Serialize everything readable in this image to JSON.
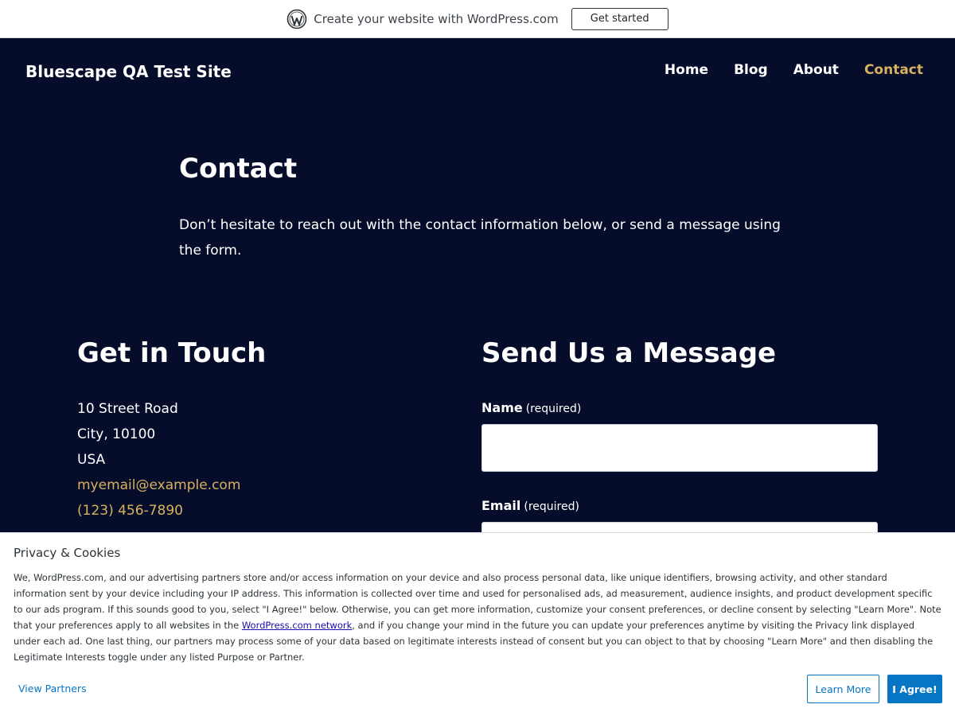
{
  "wp_banner": {
    "logo_icon": "wordpress-logo-icon",
    "text": "Create your website with WordPress.com",
    "button_label": "Get started"
  },
  "header": {
    "site_title": "Bluescape QA Test Site",
    "nav": [
      {
        "label": "Home",
        "active": false
      },
      {
        "label": "Blog",
        "active": false
      },
      {
        "label": "About",
        "active": false
      },
      {
        "label": "Contact",
        "active": true
      }
    ]
  },
  "intro": {
    "heading": "Contact",
    "text": "Don’t hesitate to reach out with the contact information below, or send a message using the form."
  },
  "get_in_touch": {
    "heading": "Get in Touch",
    "street": "10 Street Road",
    "city": "City, 10100",
    "country": "USA",
    "email": "myemail@example.com",
    "phone": "(123) 456-7890"
  },
  "form": {
    "heading": "Send Us a Message",
    "name_label": "Name",
    "name_required": "(required)",
    "name_value": "",
    "email_label": "Email",
    "email_required": "(required)",
    "email_value": ""
  },
  "cookie_banner": {
    "title": "Privacy & Cookies",
    "body_part1": "We, WordPress.com, and our advertising partners store and/or access information on your device and also process personal data, like unique identifiers, browsing activity, and other standard information sent by your device including your IP address. This information is collected over time and used for personalised ads, ad measurement, audience insights, and product development specific to our ads program. If this sounds good to you, select \"I Agree!\" below. Otherwise, you can get more information, customize your consent preferences, or decline consent by selecting \"Learn More\". Note that your preferences apply to all websites in the ",
    "body_link": "WordPress.com network",
    "body_part2": ", and if you change your mind in the future you can update your preferences anytime by visiting the Privacy link displayed under each ad. One last thing, our partners may process some of your data based on legitimate interests instead of consent but you can object to that by choosing \"Learn More\" and then disabling the Legitimate Interests toggle under any listed Purpose or Partner.",
    "view_partners": "View Partners",
    "learn_more": "Learn More",
    "agree": "I Agree!"
  },
  "colors": {
    "page_background": "#050d2b",
    "accent": "#d8b15e",
    "cookie_button_blue": "#0675c4"
  }
}
